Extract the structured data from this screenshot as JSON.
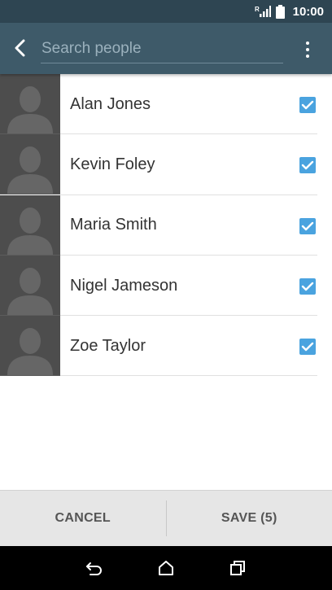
{
  "status_bar": {
    "network_label": "R",
    "time": "10:00"
  },
  "search": {
    "placeholder": "Search people",
    "value": ""
  },
  "contacts": [
    {
      "name": "Alan Jones",
      "checked": true
    },
    {
      "name": "Kevin Foley",
      "checked": true
    },
    {
      "name": "Maria Smith",
      "checked": true
    },
    {
      "name": "Nigel Jameson",
      "checked": true
    },
    {
      "name": "Zoe Taylor",
      "checked": true
    }
  ],
  "actions": {
    "cancel_label": "CANCEL",
    "save_label": "SAVE (5)"
  },
  "icons": {
    "back": "chevron-left-icon",
    "overflow": "more-vert-icon",
    "nav_back": "back-arrow-icon",
    "nav_home": "home-icon",
    "nav_recents": "recents-icon"
  },
  "colors": {
    "header": "#3e5a69",
    "status_bar": "#2e4552",
    "checkbox": "#4aa3df",
    "action_bar": "#e6e6e6"
  }
}
